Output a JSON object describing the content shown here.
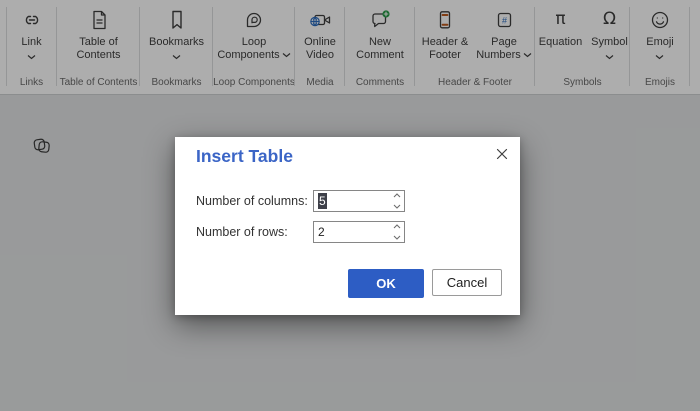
{
  "ribbon": {
    "groups": [
      {
        "label": "Links",
        "buttons": [
          {
            "label": "Link",
            "icon": "link-icon",
            "dropdown": "below"
          }
        ]
      },
      {
        "label": "Table of Contents",
        "buttons": [
          {
            "label": "Table of Contents",
            "icon": "document-toc-icon"
          }
        ]
      },
      {
        "label": "Bookmarks",
        "buttons": [
          {
            "label": "Bookmarks",
            "icon": "bookmark-icon",
            "dropdown": "below"
          }
        ]
      },
      {
        "label": "Loop Components",
        "buttons": [
          {
            "label": "Loop Components",
            "icon": "loop-icon",
            "dropdown": "inline"
          }
        ]
      },
      {
        "label": "Media",
        "buttons": [
          {
            "label": "Online Video",
            "icon": "online-video-icon"
          }
        ]
      },
      {
        "label": "Comments",
        "buttons": [
          {
            "label": "New Comment",
            "icon": "new-comment-icon"
          }
        ]
      },
      {
        "label": "Header & Footer",
        "buttons": [
          {
            "label": "Header & Footer",
            "icon": "header-footer-icon"
          },
          {
            "label": "Page Numbers",
            "icon": "page-numbers-icon",
            "dropdown": "inline"
          }
        ]
      },
      {
        "label": "Symbols",
        "buttons": [
          {
            "label": "Equation",
            "icon": "equation-icon"
          },
          {
            "label": "Symbol",
            "icon": "omega-icon",
            "dropdown": "below"
          }
        ]
      },
      {
        "label": "Emojis",
        "buttons": [
          {
            "label": "Emoji",
            "icon": "emoji-icon",
            "dropdown": "below"
          }
        ]
      }
    ]
  },
  "icons": {
    "equation_glyph": "π",
    "symbol_glyph": "Ω",
    "hash_glyph": "#"
  },
  "dialog": {
    "title": "Insert Table",
    "fields": [
      {
        "label": "Number of columns:",
        "value": "5",
        "selected": true
      },
      {
        "label": "Number of rows:",
        "value": "2",
        "selected": false
      }
    ],
    "ok_label": "OK",
    "cancel_label": "Cancel"
  },
  "colors": {
    "title_blue": "#3b65c6",
    "ok_button_blue": "#2d5dc4",
    "selection_bg": "#3e4049",
    "comment_green": "#279b48",
    "header_footer_orange": "#c05a1d",
    "icon_blue": "#2b6cbe",
    "canvas_gray": "#e2e4e5"
  }
}
